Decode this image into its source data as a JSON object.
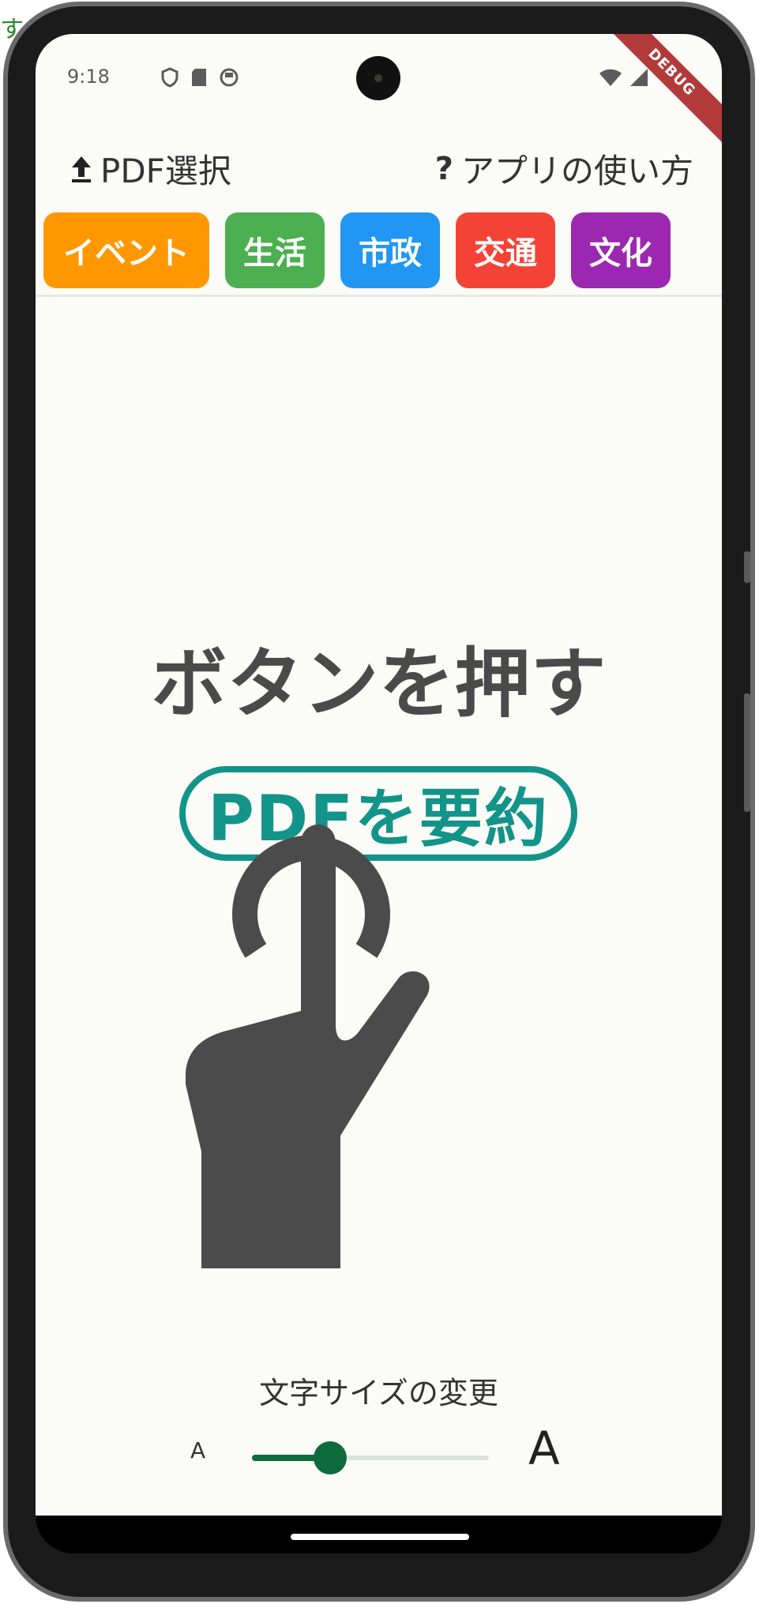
{
  "edge_fragment": "す",
  "status_bar": {
    "time": "9:18"
  },
  "debug_banner": "DEBUG",
  "topbar": {
    "pdf_select_label": "PDF選択",
    "help_label": "アプリの使い方"
  },
  "categories": [
    {
      "label": "イベント",
      "color": "#ff9800"
    },
    {
      "label": "生活",
      "color": "#4caf50"
    },
    {
      "label": "市政",
      "color": "#2196f3"
    },
    {
      "label": "交通",
      "color": "#f44336"
    },
    {
      "label": "文化",
      "color": "#9c27b0"
    }
  ],
  "instruction": {
    "headline": "ボタンを押す",
    "button_label": "PDFを要約"
  },
  "font_size": {
    "label": "文字サイズの変更",
    "min_label": "A",
    "max_label": "A",
    "value_fraction": 0.33
  },
  "colors": {
    "accent": "#0d6b3c",
    "pill": "#12948a",
    "background": "#fbfcf7"
  }
}
